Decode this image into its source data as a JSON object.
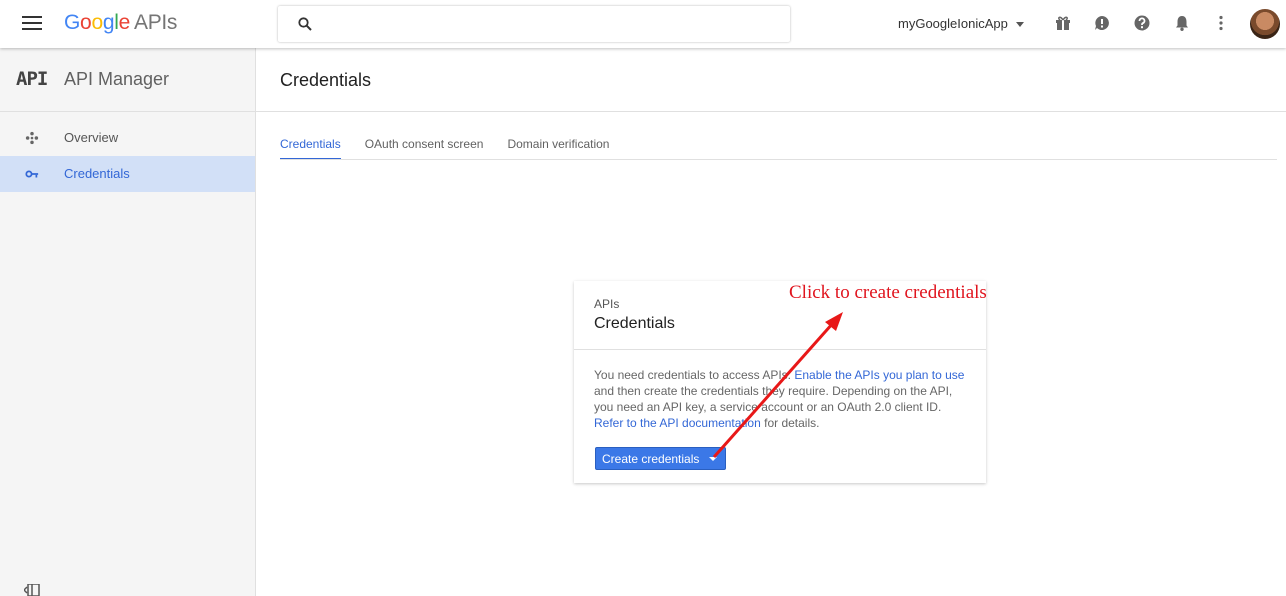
{
  "topbar": {
    "logo_google": "Google",
    "logo_apis": "APIs",
    "search_placeholder": "",
    "project_name": "myGoogleIonicApp",
    "icons": [
      "menu-icon",
      "search-icon",
      "gift-icon",
      "feedback-icon",
      "help-icon",
      "notifications-icon",
      "more-vert-icon",
      "avatar"
    ]
  },
  "sidebar": {
    "logo": "API",
    "title": "API Manager",
    "items": [
      {
        "label": "Overview",
        "icon": "overview-icon"
      },
      {
        "label": "Credentials",
        "icon": "key-icon",
        "active": true
      }
    ]
  },
  "main": {
    "title": "Credentials",
    "tabs": [
      {
        "label": "Credentials",
        "active": true
      },
      {
        "label": "OAuth consent screen"
      },
      {
        "label": "Domain verification"
      }
    ],
    "card": {
      "kicker": "APIs",
      "title": "Credentials",
      "body_1": "You need credentials to access APIs. ",
      "link_1": "Enable the APIs you plan to use",
      "body_2": " and then create the credentials they require. Depending on the API, you need an API key, a service account or an OAuth 2.0 client ID. ",
      "link_2": "Refer to the API documentation",
      "body_3": " for details.",
      "button_label": "Create credentials"
    }
  },
  "annotation": {
    "text": "Click to create credentials",
    "color": "#e0141e"
  },
  "colors": {
    "accent": "#3367d6",
    "button": "#3b78e7",
    "active_item_bg": "#d2e0f7"
  }
}
